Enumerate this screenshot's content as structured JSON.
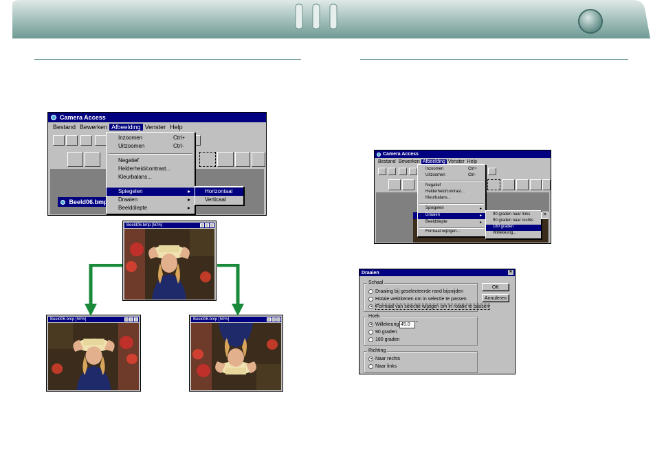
{
  "menu_top": {
    "title": "Camera Access",
    "menubar": [
      "Bestand",
      "Bewerken",
      "Afbeelding",
      "Venster",
      "Help"
    ],
    "items": [
      {
        "label": "Inzoomen",
        "shortcut": "Ctrl+"
      },
      {
        "label": "Uitzoomen",
        "shortcut": "Ctrl-"
      },
      {
        "label": "Negatief",
        "shortcut": ""
      },
      {
        "label": "Helderheid/contrast...",
        "shortcut": ""
      },
      {
        "label": "Kleurbalans...",
        "shortcut": ""
      },
      {
        "label": "Spiegelen",
        "shortcut": ""
      },
      {
        "label": "Draaien",
        "shortcut": ""
      },
      {
        "label": "Beelddiepte",
        "shortcut": ""
      }
    ],
    "submenu": [
      "Horizontaal",
      "Verticaal"
    ],
    "child_window": "Beeld06.bmp"
  },
  "photo_windows": {
    "center_title": "Beeld06.bmp [50%]",
    "left_title": "Beeld06.bmp [50%]",
    "right_title": "Beeld06.bmp [50%]"
  },
  "menu_right": {
    "title": "Camera Access",
    "menubar": [
      "Bestand",
      "Bewerken",
      "Afbeelding",
      "Venster",
      "Help"
    ],
    "items": [
      {
        "label": "Inzoomen",
        "shortcut": "Ctrl+"
      },
      {
        "label": "Uitzoomen",
        "shortcut": "Ctrl-"
      },
      {
        "label": "Negatief",
        "shortcut": ""
      },
      {
        "label": "Helderheid/contrast...",
        "shortcut": ""
      },
      {
        "label": "Kleurbalans...",
        "shortcut": ""
      },
      {
        "label": "Spiegelen",
        "shortcut": ""
      },
      {
        "label": "Draaien",
        "shortcut": ""
      },
      {
        "label": "Beelddiepte",
        "shortcut": ""
      },
      {
        "label": "Formaat wijzigen...",
        "shortcut": ""
      }
    ],
    "submenu": [
      "90 graden naar links",
      "90 graden naar rechts",
      "180 graden",
      "Willekeurig..."
    ]
  },
  "dialog": {
    "title": "Draaien",
    "ok": "OK",
    "cancel": "Annuleren",
    "group_scale": "Schaal",
    "scale_options": [
      "Draaiing bij geselecteerde rand bijsnijden",
      "Hotale wektkenen om in selectie te passen",
      "Formaat van selectie wijzigen om in rotatie te passen"
    ],
    "group_angle": "Hoek",
    "angle_options": [
      "Willekeurig",
      "90 graden",
      "180 graden"
    ],
    "angle_value": "45.0",
    "angle_unit": "°",
    "group_direction": "Richting",
    "direction_options": [
      "Naar rechts",
      "Naar links"
    ]
  },
  "colors": {
    "accent": "#6b9a96",
    "titlebar": "#000080",
    "arrow": "#1a8a3a"
  }
}
